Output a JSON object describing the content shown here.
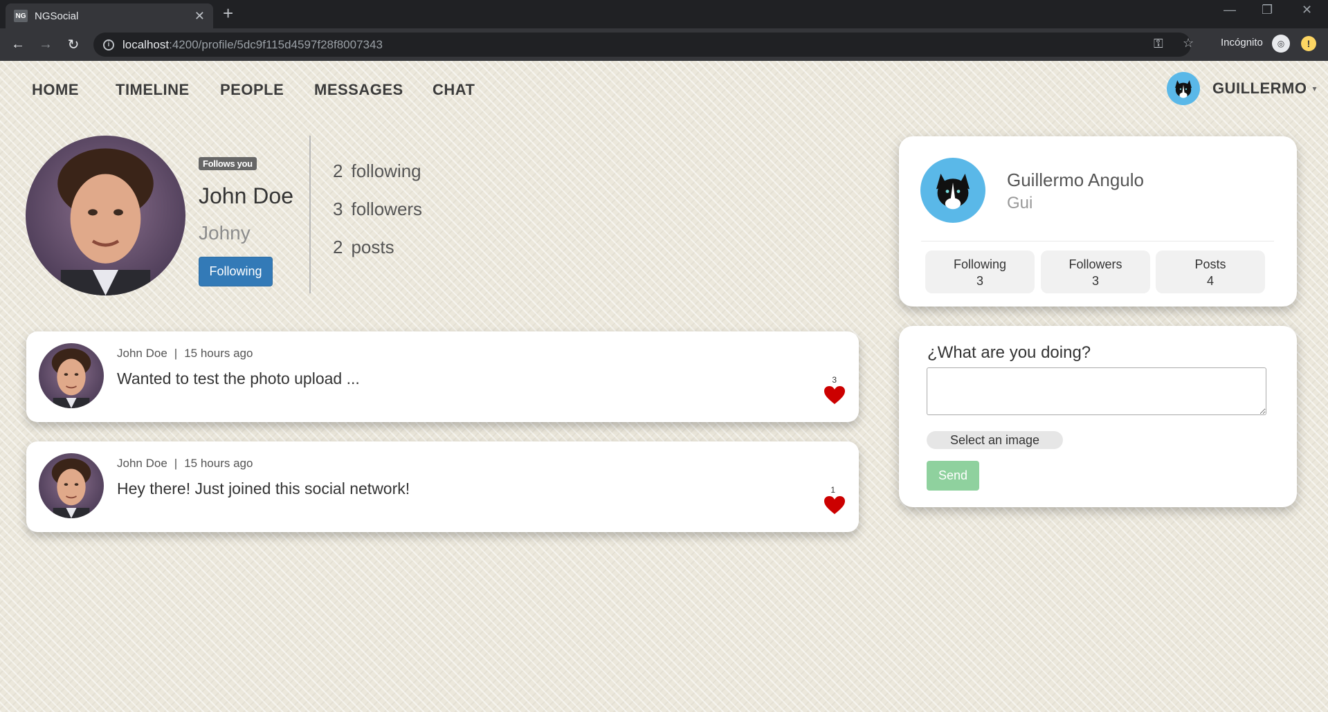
{
  "browser": {
    "tab_title": "NGSocial",
    "favicon_text": "NG",
    "url_host": "localhost",
    "url_path": ":4200/profile/5dc9f115d4597f28f8007343",
    "incognito_label": "Incógnito"
  },
  "nav": {
    "home": "HOME",
    "timeline": "TIMELINE",
    "people": "PEOPLE",
    "messages": "MESSAGES",
    "chat": "CHAT",
    "user": "GUILLERMO"
  },
  "profile": {
    "badge": "Follows you",
    "name": "John Doe",
    "nick": "Johny",
    "follow_button": "Following",
    "stats": [
      {
        "num": "2",
        "label": "following"
      },
      {
        "num": "3",
        "label": "followers"
      },
      {
        "num": "2",
        "label": "posts"
      }
    ]
  },
  "posts": [
    {
      "author": "John Doe",
      "sep": "|",
      "time": "15 hours ago",
      "text": "Wanted to test the photo upload ...",
      "likes": "3"
    },
    {
      "author": "John Doe",
      "sep": "|",
      "time": "15 hours ago",
      "text": "Hey there! Just joined this social network!",
      "likes": "1"
    }
  ],
  "me": {
    "name": "Guillermo Angulo",
    "nick": "Gui",
    "stats": [
      {
        "label": "Following",
        "value": "3"
      },
      {
        "label": "Followers",
        "value": "3"
      },
      {
        "label": "Posts",
        "value": "4"
      }
    ]
  },
  "compose": {
    "title": "¿What are you doing?",
    "select_image": "Select an image",
    "send": "Send"
  },
  "colors": {
    "primary": "#337ab7",
    "success_light": "#8fd19e",
    "heart": "#cc0000",
    "avatar_bg": "#5ab8e8"
  }
}
